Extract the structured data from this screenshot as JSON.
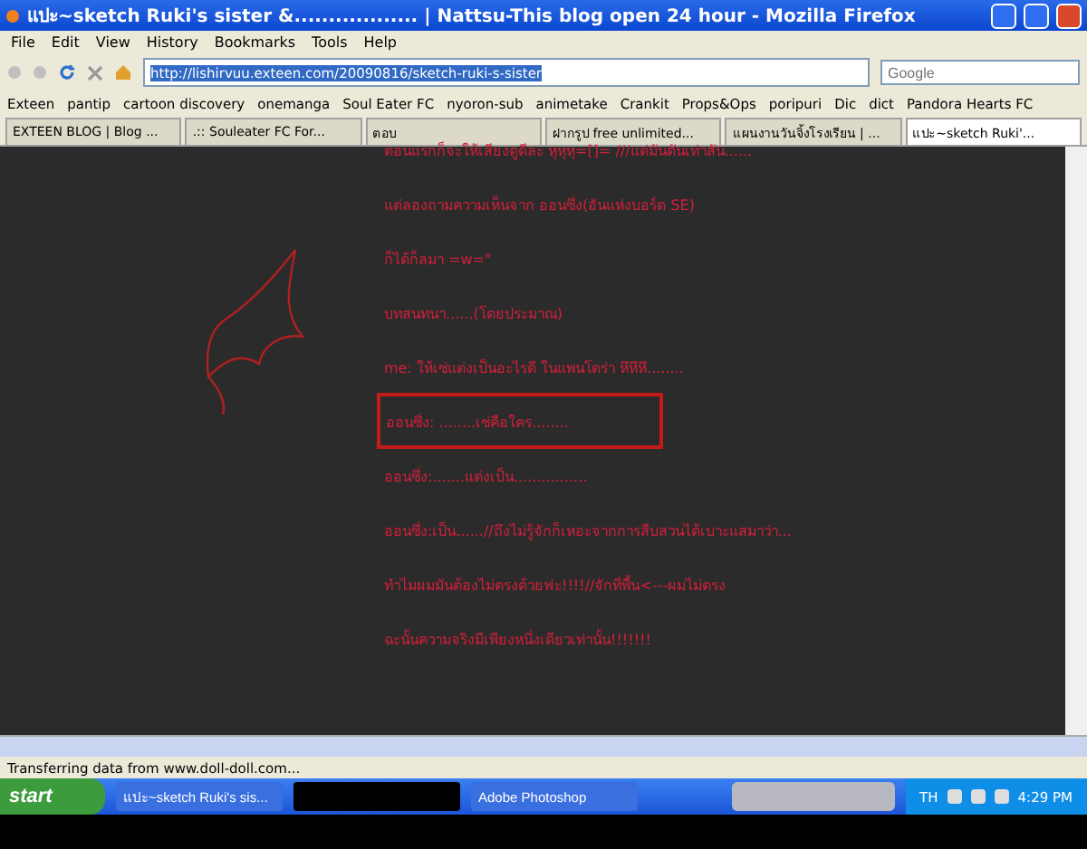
{
  "window": {
    "title": "แปะ~sketch Ruki's sister &.................. | Nattsu-This blog open 24 hour - Mozilla Firefox"
  },
  "menu": [
    "File",
    "Edit",
    "View",
    "History",
    "Bookmarks",
    "Tools",
    "Help"
  ],
  "address": {
    "value": "http://lishirvuu.exteen.com/20090816/sketch-ruki-s-sister"
  },
  "search": {
    "placeholder": "Google"
  },
  "bookmarks": [
    "Exteen",
    "pantip",
    "cartoon discovery",
    "onemanga",
    "Soul Eater FC",
    "nyoron-sub",
    "animetake",
    "Crankit",
    "Props&Ops",
    "poripuri",
    "Dic",
    "dict",
    "Pandora Hearts FC"
  ],
  "tabs": [
    {
      "label": "EXTEEN BLOG | Blog ...",
      "selected": false
    },
    {
      "label": ".:: Souleater FC For...",
      "selected": false
    },
    {
      "label": "ตอบ",
      "selected": false
    },
    {
      "label": "ฝากรูป free unlimited...",
      "selected": false
    },
    {
      "label": "แผนงานวันจิ้งโรงเรียน | ...",
      "selected": false
    },
    {
      "label": "แปะ~sketch Ruki'...",
      "selected": true
    }
  ],
  "post_lines": [
    {
      "text": "ตอนแรกก็จะให้เสียงดูดีละ หุหุหุ=[]= ///แต่มันดันเท่าสัน......",
      "boxed": false
    },
    {
      "text": "แต่ลองถามความเห็นจาก ออนซึ่ง(อันแห่งบอร์ด SE)",
      "boxed": false
    },
    {
      "text": "ก็ได้ก็ลมา =w=\"",
      "boxed": false
    },
    {
      "text": "บทสนทนา......(โดยประมาณ)",
      "boxed": false
    },
    {
      "text": "me: ให้เซ่แต่งเป็นอะไรดี ในแพนโดร่า หึหึหึ........",
      "boxed": false
    },
    {
      "text": "ออนซึ่ง: ........เซ่คือใคร........",
      "boxed": true
    },
    {
      "text": "ออนซึ่ง:.......แต่งเป็น................",
      "boxed": false
    },
    {
      "text": "ออนซึ่ง:เป็น......//ถึงไม่รู้จักก็เหอะจากการสืบสวนได้เบาะแสมาว่า...",
      "boxed": false
    },
    {
      "text": "ทำไมผมมันต้องไม่ตรงด้วยฟะ!!!!//จักที่พื้น<---ผมไม่ตรง",
      "boxed": false
    },
    {
      "text": "ฉะนั้นความจริงมีเพียงหนึ่งเดียวเท่านั้น!!!!!!!",
      "boxed": false
    }
  ],
  "status_bar": "Transferring data from www.doll-doll.com...",
  "taskbar": {
    "start": "start",
    "tasks": [
      {
        "label": "แปะ~sketch Ruki's sis...",
        "kind": "firefox"
      },
      {
        "kind": "blank"
      },
      {
        "label": "Adobe Photoshop",
        "kind": "photoshop"
      }
    ],
    "language": "TH",
    "clock": "4:29 PM"
  }
}
